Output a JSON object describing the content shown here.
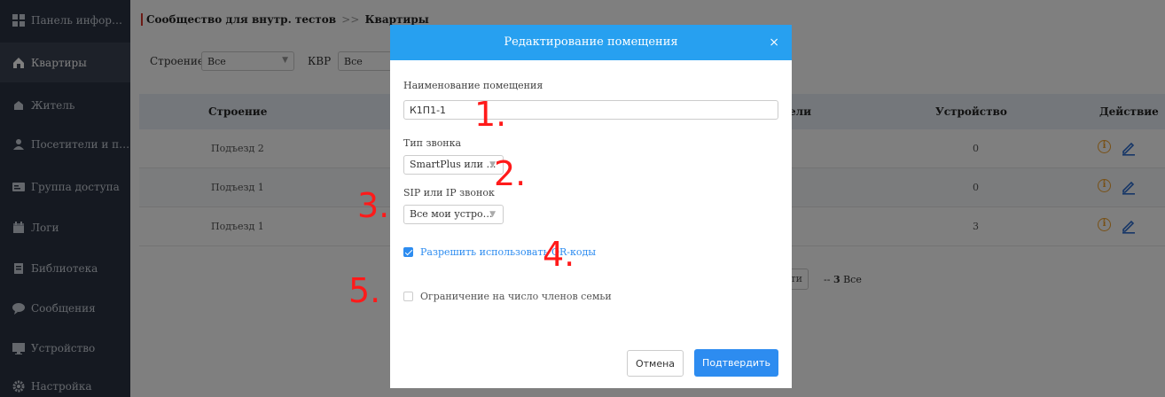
{
  "sidebar": {
    "items": [
      {
        "label": "Панель информации",
        "icon": "dashboard-icon"
      },
      {
        "label": "Квартиры",
        "icon": "apartment-icon",
        "active": true
      },
      {
        "label": "Житель",
        "icon": "resident-icon"
      },
      {
        "label": "Посетители и пер…",
        "icon": "visitor-icon"
      },
      {
        "label": "Группа доступа",
        "icon": "access-group-icon"
      },
      {
        "label": "Логи",
        "icon": "logs-icon"
      },
      {
        "label": "Библиотека",
        "icon": "library-icon"
      },
      {
        "label": "Сообщения",
        "icon": "messages-icon"
      },
      {
        "label": "Устройство",
        "icon": "device-icon"
      },
      {
        "label": "Настройка",
        "icon": "settings-icon"
      }
    ]
  },
  "breadcrumb": {
    "parent": "Сообщество для внутр. тестов",
    "separator": ">>",
    "current": "Квартиры"
  },
  "filters": {
    "building_label": "Строение",
    "building_value": "Все",
    "apt_label": "КВР",
    "apt_value": "Все"
  },
  "table": {
    "headers": {
      "building": "Строение",
      "residents": "ели",
      "device": "Устройство",
      "action": "Действие"
    },
    "rows": [
      {
        "building": "Подъезд 2",
        "device": "0"
      },
      {
        "building": "Подъезд 1",
        "device": "0"
      },
      {
        "building": "Подъезд 1",
        "device": "3"
      }
    ]
  },
  "pagination": {
    "button_fragment": "ти",
    "total_prefix": "-- ",
    "total_count": "3",
    "total_suffix": " Все"
  },
  "modal": {
    "title": "Редактирование помещения",
    "close_symbol": "×",
    "room_name_label": "Наименование помещения",
    "room_name_value": "К1П1-1",
    "ring_type_label": "Тип звонка",
    "ring_type_value": "SmartPlus или …",
    "sip_label": "SIP или IP звонок",
    "sip_value": "Все мои устро…",
    "qr_label": "Разрешить использовать QR-коды",
    "qr_checked": true,
    "family_limit_label": "Ограничение на число членов семьи",
    "family_limit_checked": false,
    "cancel_label": "Отмена",
    "confirm_label": "Подтвердить"
  },
  "annotations": [
    "1.",
    "2.",
    "3.",
    "4.",
    "5."
  ],
  "colors": {
    "sidebar_bg": "#2b3342",
    "modal_header": "#27a0f0",
    "primary_button": "#2d8cf0",
    "annotation_red": "#ff1a1a",
    "info_icon": "#f0a02a",
    "breadcrumb_accent": "#d9342b"
  }
}
